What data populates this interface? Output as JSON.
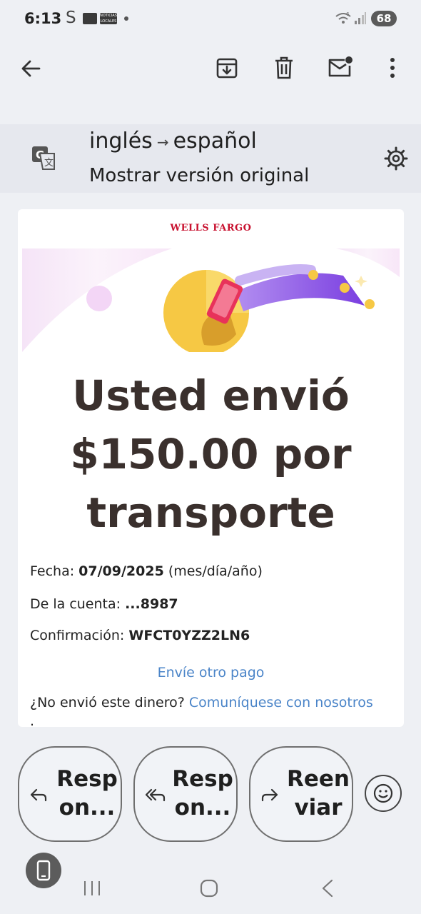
{
  "status_bar": {
    "time": "6:13",
    "app_letter": "S",
    "app_badge_text": "NOTICIAS LOCALES",
    "wifi_label": "6",
    "battery": "68"
  },
  "toolbar": {
    "back_icon": "arrow-left-icon",
    "archive_icon": "archive-icon",
    "delete_icon": "trash-icon",
    "unread_icon": "mail-unread-icon",
    "more_icon": "more-vert-icon"
  },
  "translate": {
    "source_lang": "inglés",
    "arrow": "→",
    "target_lang": "español",
    "show_original": "Mostrar versión original",
    "icon": "google-translate-icon",
    "settings_icon": "gear-icon"
  },
  "email": {
    "logo": "WELLS FARGO",
    "headline_lines": [
      "Usted envió",
      "$150.00 por",
      "transporte"
    ],
    "date_label": "Fecha:",
    "date_value": "07/09/2025",
    "date_format": "(mes/día/año)",
    "account_label": "De la cuenta:",
    "account_value": "...8987",
    "confirmation_label": "Confirmación:",
    "confirmation_value": "WFCT0YZZ2LN6",
    "send_another": "Envíe otro pago",
    "question": "¿No envió este dinero?",
    "contact_link": "Comuníquese con nosotros",
    "trailing": "."
  },
  "actions": {
    "reply": "Resp on...",
    "reply_all": "Resp on...",
    "forward": "Reen viar",
    "emoji_icon": "smiley-icon"
  },
  "colors": {
    "brand_red": "#c8102e",
    "link_blue": "#4a84c8",
    "headline": "#3a302d"
  }
}
